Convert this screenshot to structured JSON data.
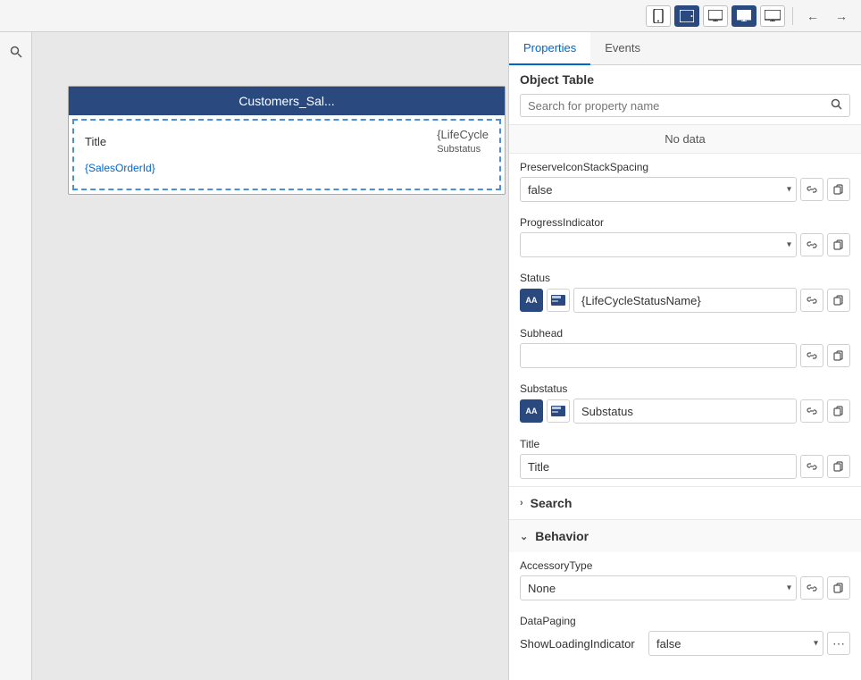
{
  "toolbar": {
    "buttons": [
      {
        "id": "mobile",
        "icon": "📱",
        "active": false,
        "label": "mobile-view"
      },
      {
        "id": "tablet",
        "icon": "⬛",
        "active": true,
        "label": "tablet-view"
      },
      {
        "id": "desktop-sm",
        "icon": "🖥",
        "active": false,
        "label": "desktop-sm-view"
      },
      {
        "id": "desktop-fill",
        "icon": "⬛",
        "active": true,
        "label": "desktop-fill-view"
      },
      {
        "id": "desktop-lg",
        "icon": "⬛",
        "active": false,
        "label": "desktop-lg-view"
      }
    ],
    "nav_back": "‹",
    "nav_forward": "›"
  },
  "canvas": {
    "component": {
      "title": "Customers_Sal...",
      "row1_label": "Title",
      "row1_value": "{LifeCycle",
      "row1_sub": "Substatus",
      "row2_value": "{SalesOrderId}"
    }
  },
  "right_panel": {
    "tabs": [
      {
        "id": "properties",
        "label": "Properties",
        "active": true
      },
      {
        "id": "events",
        "label": "Events",
        "active": false
      }
    ],
    "section_title": "Object Table",
    "search_placeholder": "Search for property name",
    "no_data_text": "No data",
    "properties": [
      {
        "id": "preserve-icon-stack-spacing",
        "label": "PreserveIconStackSpacing",
        "type": "select",
        "value": "false",
        "options": [
          "false",
          "true"
        ]
      },
      {
        "id": "progress-indicator",
        "label": "ProgressIndicator",
        "type": "select",
        "value": "",
        "options": [
          ""
        ]
      },
      {
        "id": "status",
        "label": "Status",
        "type": "input-with-icons",
        "value": "{LifeCycleStatusName}",
        "has_text_icon": true,
        "has_img_icon": true
      },
      {
        "id": "subhead",
        "label": "Subhead",
        "type": "input",
        "value": ""
      },
      {
        "id": "substatus",
        "label": "Substatus",
        "type": "input-with-icons",
        "value": "Substatus",
        "has_text_icon": true,
        "has_img_icon": true
      },
      {
        "id": "title",
        "label": "Title",
        "type": "input",
        "value": "Title"
      }
    ],
    "search_section": {
      "label": "Search",
      "collapsed": false,
      "chevron": "›"
    },
    "behavior_section": {
      "label": "Behavior",
      "collapsed": true,
      "chevron": "˅"
    },
    "behavior_props": [
      {
        "id": "accessory-type",
        "label": "AccessoryType",
        "type": "select",
        "value": "None",
        "options": [
          "None"
        ]
      },
      {
        "id": "data-paging",
        "label": "DataPaging",
        "sub_label": "ShowLoadingIndicator",
        "type": "datapaging",
        "value": "false",
        "options": [
          "false",
          "true"
        ]
      }
    ]
  }
}
